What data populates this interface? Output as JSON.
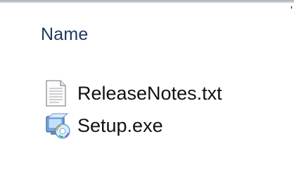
{
  "column_header": {
    "label": "Name"
  },
  "corner_mark": "'",
  "files": [
    {
      "name": "ReleaseNotes.txt",
      "icon": "text-document-icon"
    },
    {
      "name": "Setup.exe",
      "icon": "installer-icon"
    }
  ],
  "colors": {
    "header_text": "#1e395b",
    "file_text": "#111111",
    "background": "#ffffff"
  }
}
